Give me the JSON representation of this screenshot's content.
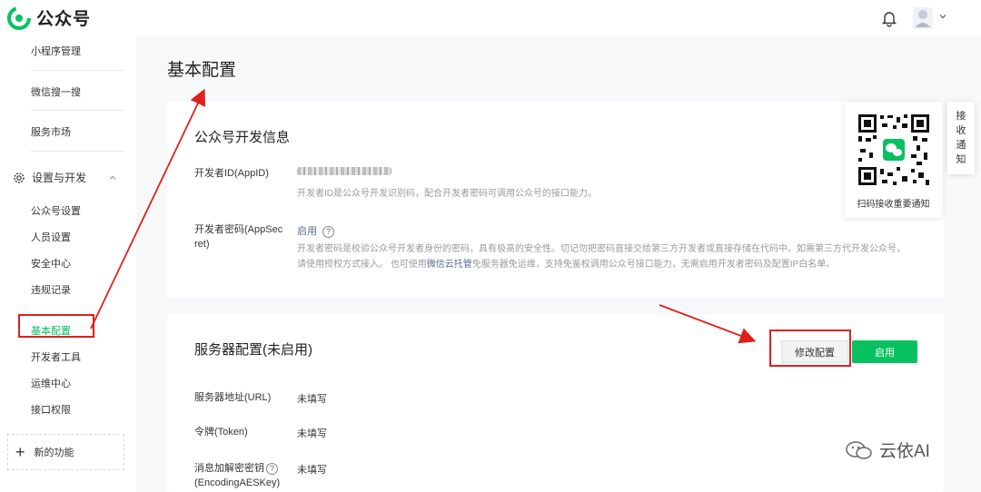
{
  "topbar": {
    "app_name": "公众号",
    "bell_icon": "bell-icon",
    "avatar_icon": "avatar-icon",
    "caret_icon": "chevron-down-icon"
  },
  "sidebar": {
    "items_top": [
      "小程序管理",
      "微信搜一搜",
      "服务市场"
    ],
    "group": {
      "label": "设置与开发",
      "icon": "gear-icon",
      "expanded_icon": "chevron-up-icon"
    },
    "sub_items": [
      "公众号设置",
      "人员设置",
      "安全中心",
      "违规记录",
      "基本配置",
      "开发者工具",
      "运维中心",
      "接口权限"
    ],
    "active_item": "基本配置",
    "new_feature": {
      "label": "新的功能",
      "icon": "plus-icon"
    }
  },
  "main": {
    "page_title": "基本配置",
    "dev_card": {
      "title": "公众号开发信息",
      "appid_label": "开发者ID(AppID)",
      "appid_desc": "开发者ID是公众号开发识别码，配合开发者密码可调用公众号的接口能力。",
      "secret_label_1": "开发者密码(AppSec",
      "secret_label_2": "ret)",
      "secret_action": "启用",
      "secret_help": "?",
      "secret_desc_1": "开发者密码是校验公众号开发者身份的密码，具有极高的安全性。切记勿把密码直接交给第三方开发者或直接存储在代码中。如需第三方代开发公众号，",
      "secret_desc_2a": "请使用授权方式接入。 也可使用",
      "secret_desc_2_link": "微信云托管",
      "secret_desc_2b": "免服务器免运维，支持免鉴权调用公众号接口能力，无需启用开发者密码及配置IP白名单。"
    },
    "server_card": {
      "title": "服务器配置(未启用)",
      "modify_button": "修改配置",
      "enable_button": "启用",
      "rows": [
        {
          "label": "服务器地址(URL)",
          "value": "未填写"
        },
        {
          "label": "令牌(Token)",
          "value": "未填写"
        },
        {
          "label": "消息加解密密钥",
          "label2": "(EncodingAESKey)",
          "value": "未填写"
        }
      ]
    }
  },
  "qr_panel": {
    "caption": "扫码接收重要通知"
  },
  "notify_tab": {
    "chars": [
      "接",
      "收",
      "通",
      "知"
    ]
  },
  "watermark": {
    "text": "云依AI",
    "icon": "wechat-icon"
  },
  "colors": {
    "brand_green": "#07c160",
    "annotation_red": "#e0201c",
    "link_blue": "#576b95"
  }
}
